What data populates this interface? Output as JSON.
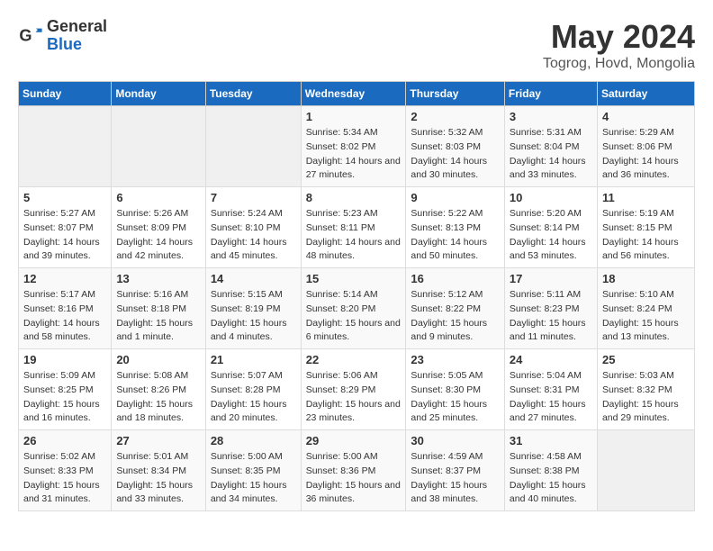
{
  "header": {
    "logo": {
      "general": "General",
      "blue": "Blue"
    },
    "title": "May 2024",
    "location": "Togrog, Hovd, Mongolia"
  },
  "weekdays": [
    "Sunday",
    "Monday",
    "Tuesday",
    "Wednesday",
    "Thursday",
    "Friday",
    "Saturday"
  ],
  "weeks": [
    [
      {
        "day": "",
        "info": ""
      },
      {
        "day": "",
        "info": ""
      },
      {
        "day": "",
        "info": ""
      },
      {
        "day": "1",
        "sunrise": "5:34 AM",
        "sunset": "8:02 PM",
        "daylight": "14 hours and 27 minutes."
      },
      {
        "day": "2",
        "sunrise": "5:32 AM",
        "sunset": "8:03 PM",
        "daylight": "14 hours and 30 minutes."
      },
      {
        "day": "3",
        "sunrise": "5:31 AM",
        "sunset": "8:04 PM",
        "daylight": "14 hours and 33 minutes."
      },
      {
        "day": "4",
        "sunrise": "5:29 AM",
        "sunset": "8:06 PM",
        "daylight": "14 hours and 36 minutes."
      }
    ],
    [
      {
        "day": "5",
        "sunrise": "5:27 AM",
        "sunset": "8:07 PM",
        "daylight": "14 hours and 39 minutes."
      },
      {
        "day": "6",
        "sunrise": "5:26 AM",
        "sunset": "8:09 PM",
        "daylight": "14 hours and 42 minutes."
      },
      {
        "day": "7",
        "sunrise": "5:24 AM",
        "sunset": "8:10 PM",
        "daylight": "14 hours and 45 minutes."
      },
      {
        "day": "8",
        "sunrise": "5:23 AM",
        "sunset": "8:11 PM",
        "daylight": "14 hours and 48 minutes."
      },
      {
        "day": "9",
        "sunrise": "5:22 AM",
        "sunset": "8:13 PM",
        "daylight": "14 hours and 50 minutes."
      },
      {
        "day": "10",
        "sunrise": "5:20 AM",
        "sunset": "8:14 PM",
        "daylight": "14 hours and 53 minutes."
      },
      {
        "day": "11",
        "sunrise": "5:19 AM",
        "sunset": "8:15 PM",
        "daylight": "14 hours and 56 minutes."
      }
    ],
    [
      {
        "day": "12",
        "sunrise": "5:17 AM",
        "sunset": "8:16 PM",
        "daylight": "14 hours and 58 minutes."
      },
      {
        "day": "13",
        "sunrise": "5:16 AM",
        "sunset": "8:18 PM",
        "daylight": "15 hours and 1 minute."
      },
      {
        "day": "14",
        "sunrise": "5:15 AM",
        "sunset": "8:19 PM",
        "daylight": "15 hours and 4 minutes."
      },
      {
        "day": "15",
        "sunrise": "5:14 AM",
        "sunset": "8:20 PM",
        "daylight": "15 hours and 6 minutes."
      },
      {
        "day": "16",
        "sunrise": "5:12 AM",
        "sunset": "8:22 PM",
        "daylight": "15 hours and 9 minutes."
      },
      {
        "day": "17",
        "sunrise": "5:11 AM",
        "sunset": "8:23 PM",
        "daylight": "15 hours and 11 minutes."
      },
      {
        "day": "18",
        "sunrise": "5:10 AM",
        "sunset": "8:24 PM",
        "daylight": "15 hours and 13 minutes."
      }
    ],
    [
      {
        "day": "19",
        "sunrise": "5:09 AM",
        "sunset": "8:25 PM",
        "daylight": "15 hours and 16 minutes."
      },
      {
        "day": "20",
        "sunrise": "5:08 AM",
        "sunset": "8:26 PM",
        "daylight": "15 hours and 18 minutes."
      },
      {
        "day": "21",
        "sunrise": "5:07 AM",
        "sunset": "8:28 PM",
        "daylight": "15 hours and 20 minutes."
      },
      {
        "day": "22",
        "sunrise": "5:06 AM",
        "sunset": "8:29 PM",
        "daylight": "15 hours and 23 minutes."
      },
      {
        "day": "23",
        "sunrise": "5:05 AM",
        "sunset": "8:30 PM",
        "daylight": "15 hours and 25 minutes."
      },
      {
        "day": "24",
        "sunrise": "5:04 AM",
        "sunset": "8:31 PM",
        "daylight": "15 hours and 27 minutes."
      },
      {
        "day": "25",
        "sunrise": "5:03 AM",
        "sunset": "8:32 PM",
        "daylight": "15 hours and 29 minutes."
      }
    ],
    [
      {
        "day": "26",
        "sunrise": "5:02 AM",
        "sunset": "8:33 PM",
        "daylight": "15 hours and 31 minutes."
      },
      {
        "day": "27",
        "sunrise": "5:01 AM",
        "sunset": "8:34 PM",
        "daylight": "15 hours and 33 minutes."
      },
      {
        "day": "28",
        "sunrise": "5:00 AM",
        "sunset": "8:35 PM",
        "daylight": "15 hours and 34 minutes."
      },
      {
        "day": "29",
        "sunrise": "5:00 AM",
        "sunset": "8:36 PM",
        "daylight": "15 hours and 36 minutes."
      },
      {
        "day": "30",
        "sunrise": "4:59 AM",
        "sunset": "8:37 PM",
        "daylight": "15 hours and 38 minutes."
      },
      {
        "day": "31",
        "sunrise": "4:58 AM",
        "sunset": "8:38 PM",
        "daylight": "15 hours and 40 minutes."
      },
      {
        "day": "",
        "info": ""
      }
    ]
  ],
  "labels": {
    "sunrise": "Sunrise:",
    "sunset": "Sunset:",
    "daylight": "Daylight:"
  }
}
